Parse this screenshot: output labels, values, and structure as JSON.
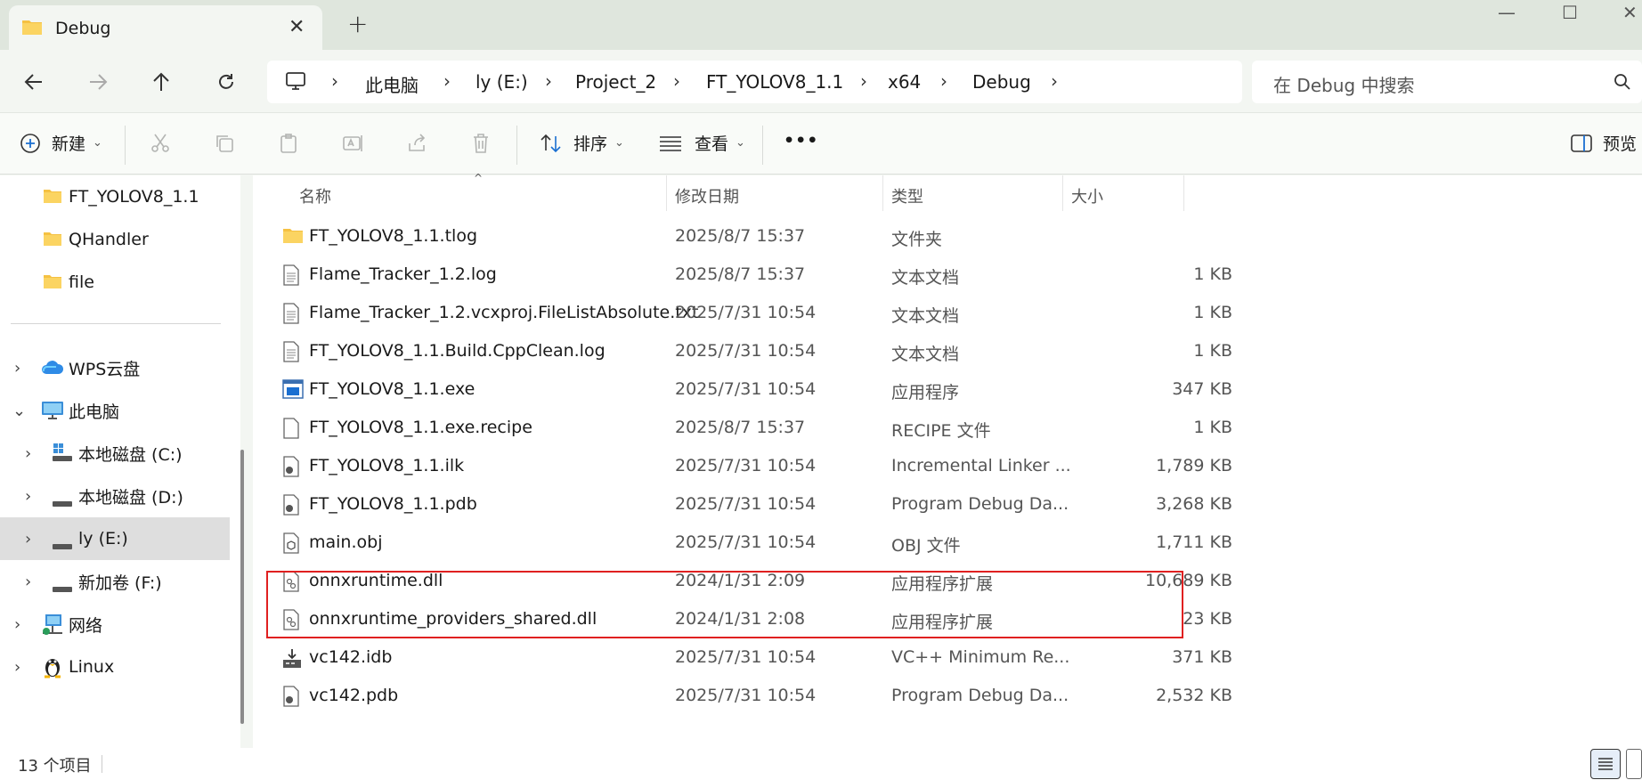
{
  "window": {
    "tab_title": "Debug",
    "tab_close": "✕",
    "new_tab": "+",
    "minimize": "—",
    "maximize": "☐",
    "close": "✕"
  },
  "nav": {
    "back_icon": "arrow-left-icon",
    "forward_icon": "arrow-right-icon",
    "up_icon": "arrow-up-icon",
    "refresh_icon": "refresh-icon"
  },
  "breadcrumb": [
    "此电脑",
    "ly (E:)",
    "Project_2",
    "FT_YOLOV8_1.1",
    "x64",
    "Debug"
  ],
  "search": {
    "placeholder": "在 Debug 中搜索"
  },
  "toolbar": {
    "new_label": "新建",
    "sort_label": "排序",
    "view_label": "查看",
    "more_label": "•••",
    "preview_label": "预览"
  },
  "sidebar": {
    "items": [
      {
        "label": "FT_YOLOV8_1.1",
        "icon": "folder-icon"
      },
      {
        "label": "QHandler",
        "icon": "folder-icon"
      },
      {
        "label": "file",
        "icon": "folder-icon"
      },
      {
        "label": "WPS云盘",
        "icon": "cloud-icon"
      },
      {
        "label": "此电脑",
        "icon": "pc-icon"
      },
      {
        "label": "本地磁盘 (C:)",
        "icon": "drive-icon"
      },
      {
        "label": "本地磁盘 (D:)",
        "icon": "drive-icon"
      },
      {
        "label": "ly (E:)",
        "icon": "drive-icon"
      },
      {
        "label": "新加卷 (F:)",
        "icon": "drive-icon"
      },
      {
        "label": "网络",
        "icon": "network-icon"
      },
      {
        "label": "Linux",
        "icon": "linux-icon"
      }
    ]
  },
  "columns": [
    "名称",
    "修改日期",
    "类型",
    "大小"
  ],
  "files": [
    {
      "name": "FT_YOLOV8_1.1.tlog",
      "date": "2025/8/7 15:37",
      "type": "文件夹",
      "size": "",
      "icon": "folder-icon"
    },
    {
      "name": "Flame_Tracker_1.2.log",
      "date": "2025/8/7 15:37",
      "type": "文本文档",
      "size": "1 KB",
      "icon": "text-file-icon"
    },
    {
      "name": "Flame_Tracker_1.2.vcxproj.FileListAbsolute.txt",
      "date": "2025/7/31 10:54",
      "type": "文本文档",
      "size": "1 KB",
      "icon": "text-file-icon"
    },
    {
      "name": "FT_YOLOV8_1.1.Build.CppClean.log",
      "date": "2025/7/31 10:54",
      "type": "文本文档",
      "size": "1 KB",
      "icon": "text-file-icon"
    },
    {
      "name": "FT_YOLOV8_1.1.exe",
      "date": "2025/7/31 10:54",
      "type": "应用程序",
      "size": "347 KB",
      "icon": "exe-icon"
    },
    {
      "name": "FT_YOLOV8_1.1.exe.recipe",
      "date": "2025/8/7 15:37",
      "type": "RECIPE 文件",
      "size": "1 KB",
      "icon": "file-icon"
    },
    {
      "name": "FT_YOLOV8_1.1.ilk",
      "date": "2025/7/31 10:54",
      "type": "Incremental Linker ...",
      "size": "1,789 KB",
      "icon": "ilk-file-icon"
    },
    {
      "name": "FT_YOLOV8_1.1.pdb",
      "date": "2025/7/31 10:54",
      "type": "Program Debug Da...",
      "size": "3,268 KB",
      "icon": "pdb-file-icon"
    },
    {
      "name": "main.obj",
      "date": "2025/7/31 10:54",
      "type": "OBJ 文件",
      "size": "1,711 KB",
      "icon": "obj-file-icon"
    },
    {
      "name": "onnxruntime.dll",
      "date": "2024/1/31 2:09",
      "type": "应用程序扩展",
      "size": "10,689 KB",
      "icon": "dll-file-icon"
    },
    {
      "name": "onnxruntime_providers_shared.dll",
      "date": "2024/1/31 2:08",
      "type": "应用程序扩展",
      "size": "23 KB",
      "icon": "dll-file-icon"
    },
    {
      "name": "vc142.idb",
      "date": "2025/7/31 10:54",
      "type": "VC++ Minimum Re...",
      "size": "371 KB",
      "icon": "idb-file-icon"
    },
    {
      "name": "vc142.pdb",
      "date": "2025/7/31 10:54",
      "type": "Program Debug Da...",
      "size": "2,532 KB",
      "icon": "pdb-file-icon"
    }
  ],
  "status": {
    "count": "13 个项目"
  },
  "colors": {
    "highlight_border": "#e02020",
    "folder": "#f5c142",
    "accent": "#1a6fd1"
  }
}
